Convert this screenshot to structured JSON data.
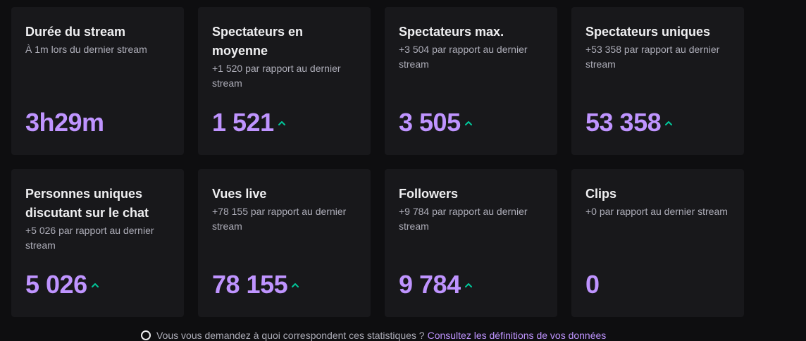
{
  "colors": {
    "page_bg": "#0e0e10",
    "card_bg": "#18181b",
    "title": "#efeff1",
    "subtitle": "#adadb8",
    "value": "#bf94ff",
    "trend_up": "#00c79a"
  },
  "cards": [
    {
      "title": "Durée du stream",
      "subtitle": "À 1m lors du dernier stream",
      "value": "3h29m",
      "trend": "none"
    },
    {
      "title": "Spectateurs en moyenne",
      "subtitle": "+1 520 par rapport au dernier stream",
      "value": "1 521",
      "trend": "up"
    },
    {
      "title": "Spectateurs max.",
      "subtitle": "+3 504 par rapport au dernier stream",
      "value": "3 505",
      "trend": "up"
    },
    {
      "title": "Spectateurs uniques",
      "subtitle": "+53 358 par rapport au dernier stream",
      "value": "53 358",
      "trend": "up"
    },
    {
      "title": "Personnes uniques discutant sur le chat",
      "subtitle": "+5 026 par rapport au dernier stream",
      "value": "5 026",
      "trend": "up"
    },
    {
      "title": "Vues live",
      "subtitle": "+78 155 par rapport au dernier stream",
      "value": "78 155",
      "trend": "up"
    },
    {
      "title": "Followers",
      "subtitle": "+9 784 par rapport au dernier stream",
      "value": "9 784",
      "trend": "up"
    },
    {
      "title": "Clips",
      "subtitle": "+0 par rapport au dernier stream",
      "value": "0",
      "trend": "none"
    }
  ],
  "footer": {
    "text": "Vous vous demandez à quoi correspondent ces statistiques ?",
    "link": "Consultez les définitions de vos données"
  }
}
